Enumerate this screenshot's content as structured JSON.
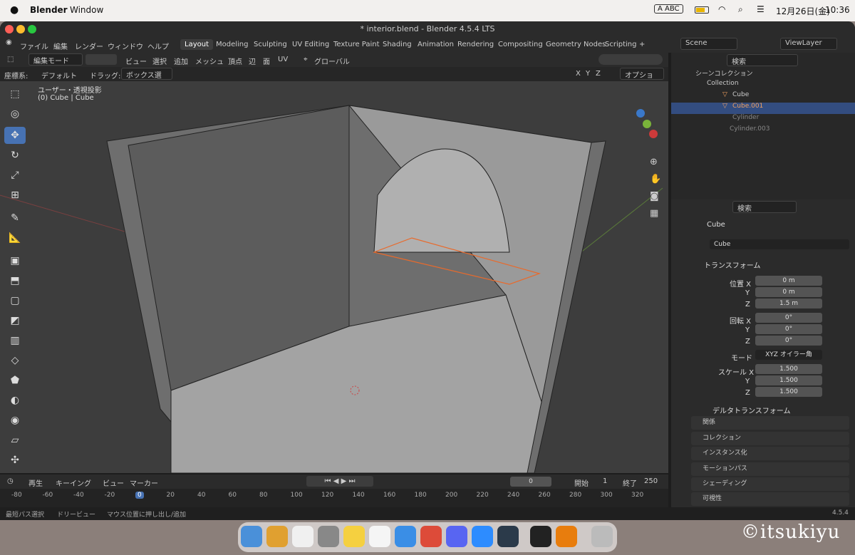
{
  "menubar": {
    "apple": "",
    "app": "Blender",
    "window": "Window",
    "date": "12月26日(金)",
    "time": "10:36",
    "input": "ABC"
  },
  "title": "* interior.blend - Blender 4.5.4 LTS",
  "topmenu": [
    "ファイル",
    "編集",
    "レンダー",
    "ウィンドウ",
    "ヘルプ"
  ],
  "workspaces": [
    "Layout",
    "Modeling",
    "Sculpting",
    "UV Editing",
    "Texture Paint",
    "Shading",
    "Animation",
    "Rendering",
    "Compositing",
    "Geometry Nodes",
    "Scripting"
  ],
  "scene": "Scene",
  "viewlayer": "ViewLayer",
  "vp": {
    "mode": "編集モード",
    "menus": [
      "ビュー",
      "選択",
      "追加",
      "メッシュ",
      "頂点",
      "辺",
      "面",
      "UV"
    ],
    "orient": "グローバル",
    "coord_label": "座標系:",
    "coord_value": "デフォルト",
    "drag_label": "ドラッグ:",
    "drag_value": "ボックス選択",
    "xyz": [
      "X",
      "Y",
      "Z"
    ],
    "options": "オプション",
    "view_name": "ユーザー・透視投影",
    "object_info": "(0) Cube | Cube"
  },
  "outliner": {
    "search": "検索",
    "scene_coll": "シーンコレクション",
    "items": [
      {
        "label": "Collection"
      },
      {
        "label": "Cube"
      },
      {
        "label": "Cube.001"
      },
      {
        "label": "Cylinder"
      },
      {
        "label": "Cylinder.003"
      }
    ]
  },
  "props": {
    "search": "検索",
    "object": "Cube",
    "name": "Cube",
    "transform": "トランスフォーム",
    "loc_label": "位置 X",
    "rot_label": "回転 X",
    "loc": [
      "0 m",
      "0 m",
      "1.5 m"
    ],
    "rot": [
      "0°",
      "0°",
      "0°"
    ],
    "mode_label": "モード",
    "mode": "XYZ オイラー角",
    "scale_label": "スケール X",
    "scale": [
      "1.500",
      "1.500",
      "1.500"
    ],
    "y": "Y",
    "z": "Z",
    "delta": "デルタトランスフォーム",
    "sections": [
      "関係",
      "コレクション",
      "インスタンス化",
      "モーションパス",
      "シェーディング",
      "可視性"
    ]
  },
  "timeline": {
    "play": "再生",
    "keying": "キーイング",
    "view": "ビュー",
    "marker": "マーカー",
    "frame": "0",
    "start_label": "開始",
    "start": "1",
    "end_label": "終了",
    "end": "250",
    "ticks": [
      "-80",
      "-60",
      "-40",
      "-20",
      "0",
      "20",
      "40",
      "60",
      "80",
      "100",
      "120",
      "140",
      "160",
      "180",
      "200",
      "220",
      "240",
      "260",
      "280",
      "300",
      "320"
    ]
  },
  "status": {
    "items": [
      "最短パス選択",
      "ドリービュー",
      "マウス位置に押し出し/追加"
    ],
    "version": "4.5.4"
  },
  "watermark": "©itsukiyu"
}
